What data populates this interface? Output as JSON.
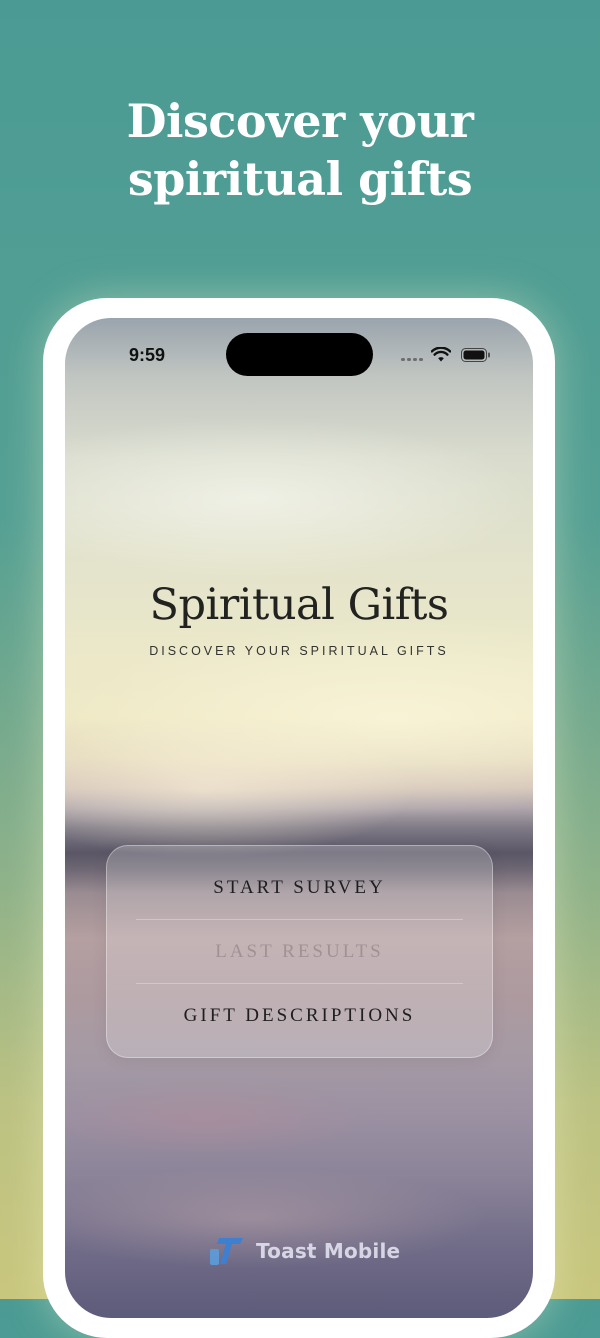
{
  "headline": {
    "line1": "Discover your",
    "line2": "spiritual gifts"
  },
  "status_bar": {
    "time": "9:59",
    "icons": [
      "cellular-signal-icon",
      "wifi-icon",
      "battery-icon"
    ]
  },
  "app": {
    "title": "Spiritual Gifts",
    "subtitle": "DISCOVER YOUR SPIRITUAL GIFTS"
  },
  "menu": {
    "items": [
      {
        "label": "START SURVEY",
        "enabled": true
      },
      {
        "label": "LAST RESULTS",
        "enabled": false
      },
      {
        "label": "GIFT DESCRIPTIONS",
        "enabled": true
      }
    ]
  },
  "brand": {
    "logo_icon": "toast-logo-icon",
    "name": "Toast Mobile"
  },
  "colors": {
    "background_top": "#4b9b94",
    "background_bottom": "#c9c77e",
    "headline_text": "#ffffff",
    "phone_frame": "#ffffff",
    "title_text": "#222220",
    "disabled_text": "#a89ea3",
    "brand_blue": "#3e7fd0"
  }
}
